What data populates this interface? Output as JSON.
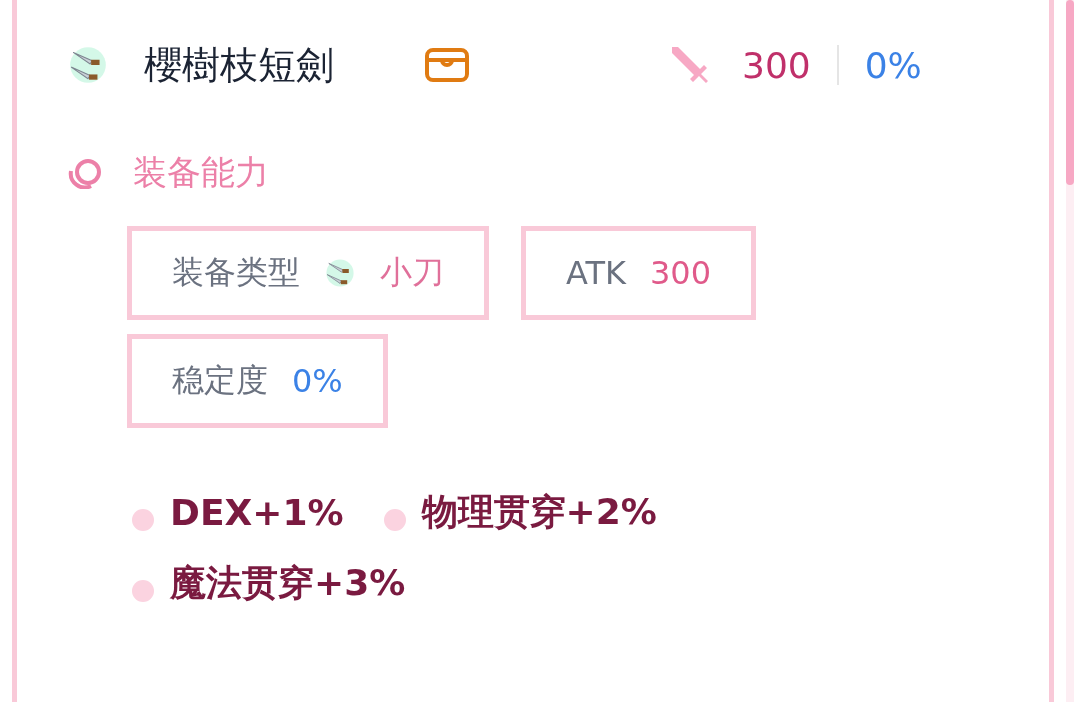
{
  "item": {
    "name": "櫻樹枝短劍",
    "attack": "300",
    "stability": "0%"
  },
  "section": {
    "title": "装备能力"
  },
  "stats": [
    {
      "kind": "type",
      "label": "装备类型",
      "value": "小刀"
    },
    {
      "kind": "attack",
      "label": "ATK",
      "value": "300"
    },
    {
      "kind": "stability",
      "label": "稳定度",
      "value": "0%"
    }
  ],
  "effects": [
    "DEX+1%",
    "物理贯穿+2%",
    "魔法贯穿+3%"
  ]
}
